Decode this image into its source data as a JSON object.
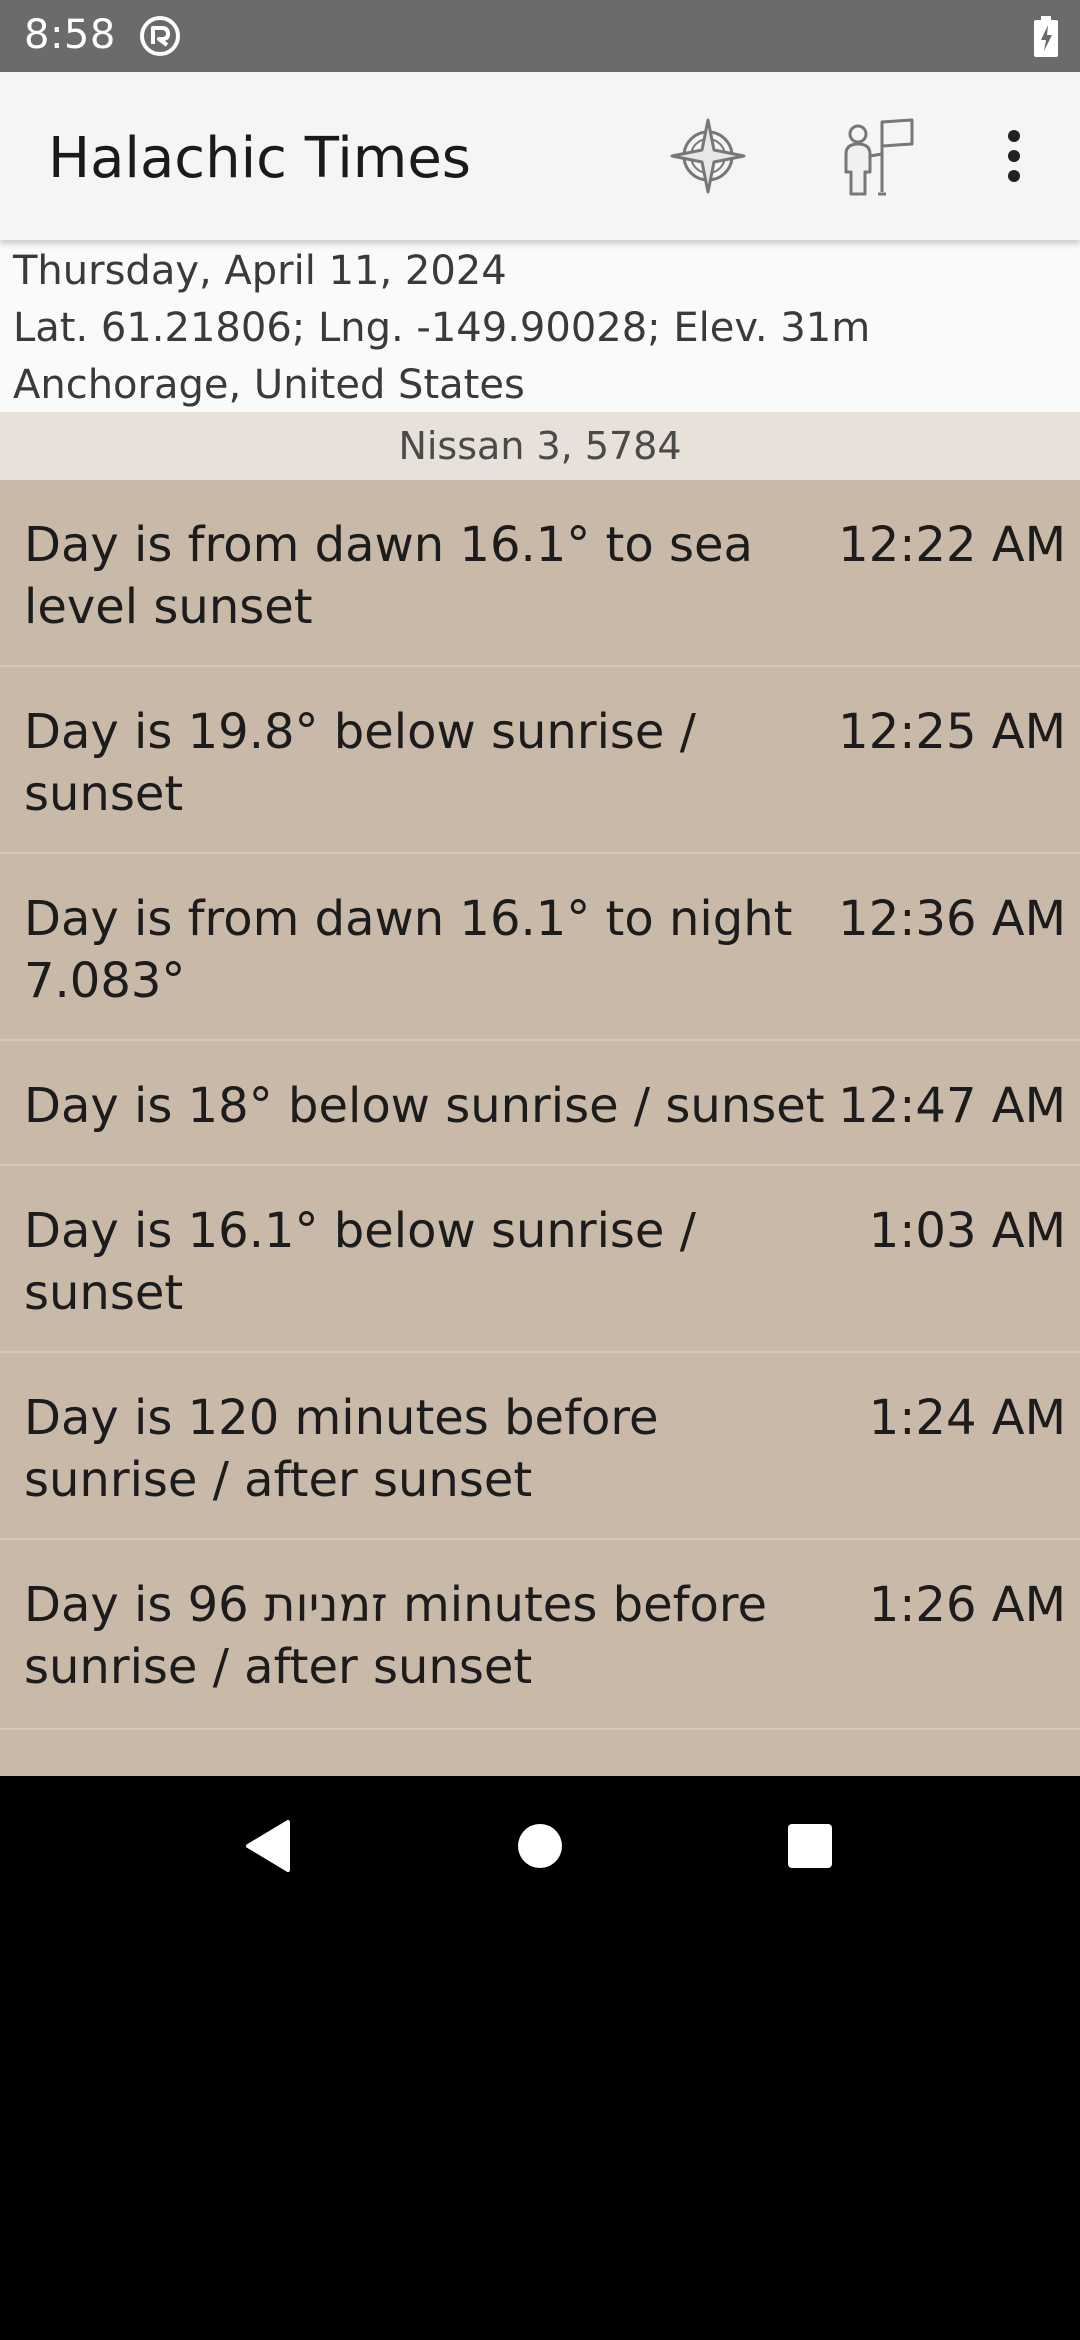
{
  "status_bar": {
    "time": "8:58",
    "cast_icon": "cast-icon",
    "battery_icon": "battery-charging-icon"
  },
  "app_bar": {
    "title": "Halachic Times",
    "actions": [
      "compass-icon",
      "location-icon",
      "more-vert-icon"
    ]
  },
  "header": {
    "date": "Thursday, April 11, 2024",
    "coordinates": "Lat. 61.21806; Lng. -149.90028; Elev. 31m",
    "place": "Anchorage, United States"
  },
  "hebrew_date": "Nissan 3, 5784",
  "items": [
    {
      "label": "Day is from dawn 16.1° to sea level sunset",
      "time": "12:22 AM"
    },
    {
      "label": "Day is 19.8° below sunrise / sunset",
      "time": "12:25 AM"
    },
    {
      "label": "Day is from dawn 16.1° to night 7.083°",
      "time": "12:36 AM"
    },
    {
      "label": "Day is 18° below sunrise / sunset",
      "time": "12:47 AM"
    },
    {
      "label": "Day is 16.1° below sunrise / sunset",
      "time": "1:03 AM"
    },
    {
      "label": "Day is 120 minutes before sunrise / after sunset",
      "time": "1:24 AM"
    },
    {
      "label": "Day is 96 זמניות minutes before sunrise / after sunset",
      "time": "1:26 AM"
    }
  ],
  "nav_bar": {
    "buttons": [
      "back-icon",
      "home-icon",
      "recents-icon"
    ]
  },
  "colors": {
    "status_bar": "#6b6b6b",
    "app_bar": "#f5f5f5",
    "hebrew_bar": "#e7e1d9",
    "list_background": "#c8b9a8"
  }
}
